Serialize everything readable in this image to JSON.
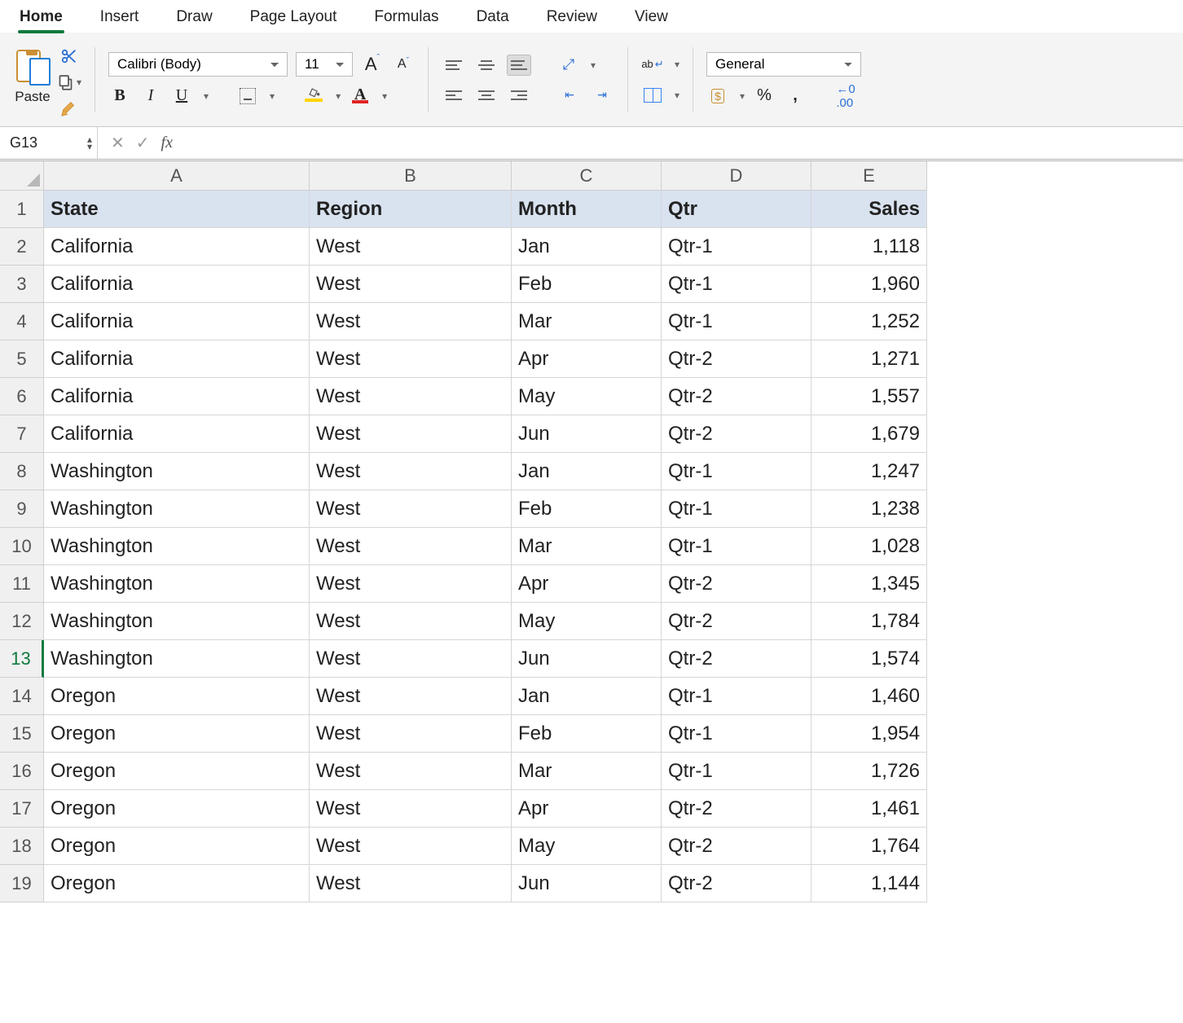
{
  "tabs": [
    "Home",
    "Insert",
    "Draw",
    "Page Layout",
    "Formulas",
    "Data",
    "Review",
    "View"
  ],
  "active_tab": "Home",
  "clipboard": {
    "paste_label": "Paste"
  },
  "font": {
    "name": "Calibri (Body)",
    "size": "11",
    "bold": "B",
    "italic": "I",
    "underline": "U"
  },
  "number_format": {
    "value": "General"
  },
  "name_box": "G13",
  "columns": [
    "A",
    "B",
    "C",
    "D",
    "E"
  ],
  "chart_data": {
    "type": "table",
    "columns": [
      "State",
      "Region",
      "Month",
      "Qtr",
      "Sales"
    ],
    "rows": [
      [
        "California",
        "West",
        "Jan",
        "Qtr-1",
        "1,118"
      ],
      [
        "California",
        "West",
        "Feb",
        "Qtr-1",
        "1,960"
      ],
      [
        "California",
        "West",
        "Mar",
        "Qtr-1",
        "1,252"
      ],
      [
        "California",
        "West",
        "Apr",
        "Qtr-2",
        "1,271"
      ],
      [
        "California",
        "West",
        "May",
        "Qtr-2",
        "1,557"
      ],
      [
        "California",
        "West",
        "Jun",
        "Qtr-2",
        "1,679"
      ],
      [
        "Washington",
        "West",
        "Jan",
        "Qtr-1",
        "1,247"
      ],
      [
        "Washington",
        "West",
        "Feb",
        "Qtr-1",
        "1,238"
      ],
      [
        "Washington",
        "West",
        "Mar",
        "Qtr-1",
        "1,028"
      ],
      [
        "Washington",
        "West",
        "Apr",
        "Qtr-2",
        "1,345"
      ],
      [
        "Washington",
        "West",
        "May",
        "Qtr-2",
        "1,784"
      ],
      [
        "Washington",
        "West",
        "Jun",
        "Qtr-2",
        "1,574"
      ],
      [
        "Oregon",
        "West",
        "Jan",
        "Qtr-1",
        "1,460"
      ],
      [
        "Oregon",
        "West",
        "Feb",
        "Qtr-1",
        "1,954"
      ],
      [
        "Oregon",
        "West",
        "Mar",
        "Qtr-1",
        "1,726"
      ],
      [
        "Oregon",
        "West",
        "Apr",
        "Qtr-2",
        "1,461"
      ],
      [
        "Oregon",
        "West",
        "May",
        "Qtr-2",
        "1,764"
      ],
      [
        "Oregon",
        "West",
        "Jun",
        "Qtr-2",
        "1,144"
      ]
    ]
  },
  "active_row_num": 13,
  "colors": {
    "accent": "#0f7a3d",
    "fill_highlight": "#ffd500",
    "font_color": "#e02424"
  }
}
